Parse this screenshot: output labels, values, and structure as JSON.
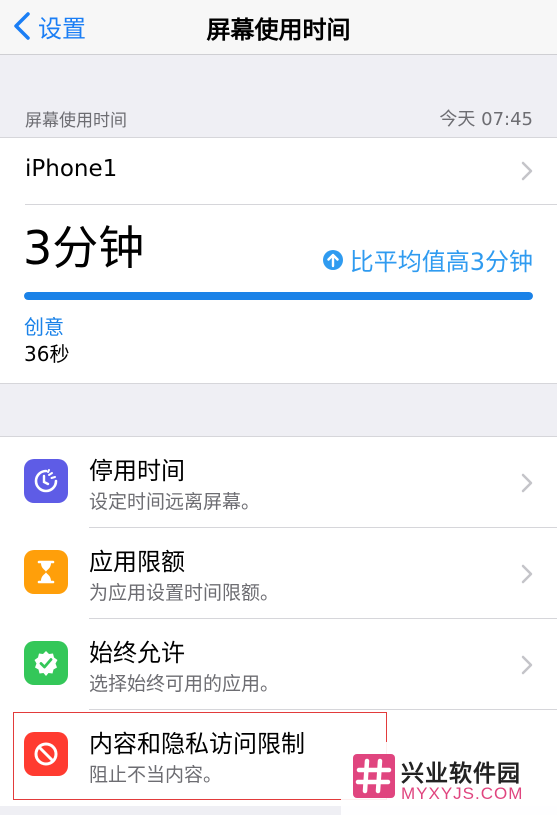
{
  "nav": {
    "back_label": "设置",
    "title": "屏幕使用时间"
  },
  "summary_header": {
    "title": "屏幕使用时间",
    "time": "今天 07:45"
  },
  "summary": {
    "device": "iPhone1",
    "total": "3分钟",
    "comparison": "比平均值高3分钟",
    "usage_fraction": 1.0,
    "category_name": "创意",
    "category_time": "36秒",
    "bar_color": "#1a82e8"
  },
  "items": [
    {
      "title": "停用时间",
      "subtitle": "设定时间远离屏幕。",
      "icon": "downtime-icon",
      "color": "#5e5ce6"
    },
    {
      "title": "应用限额",
      "subtitle": "为应用设置时间限额。",
      "icon": "hourglass-icon",
      "color": "#ff9f0a"
    },
    {
      "title": "始终允许",
      "subtitle": "选择始终可用的应用。",
      "icon": "checkmark-seal-icon",
      "color": "#34c759"
    },
    {
      "title": "内容和隐私访问限制",
      "subtitle": "阻止不当内容。",
      "icon": "restriction-icon",
      "color": "#ff3b30"
    }
  ],
  "watermark": {
    "name": "兴业软件园",
    "domain": "MYXYJS.COM",
    "logo_color": "#e0457f"
  }
}
